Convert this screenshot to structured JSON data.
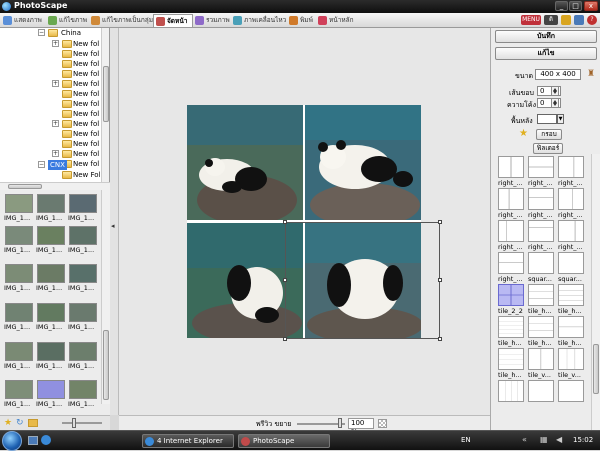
{
  "window": {
    "title": "PhotoScape"
  },
  "title_buttons": [
    "_",
    "□",
    "x"
  ],
  "tabs": [
    {
      "label": "แสดงภาพ",
      "color": "#5a8fd8"
    },
    {
      "label": "แก้ไขภาพ",
      "color": "#6aa84f"
    },
    {
      "label": "แก้ไขภาพเป็นกลุ่ม",
      "color": "#d08a3a"
    },
    {
      "label": "จัดหน้า",
      "color": "#c0504d"
    },
    {
      "label": "รวมภาพ",
      "color": "#8e6ac8"
    },
    {
      "label": "ภาพเคลื่อนไหว",
      "color": "#4aa0b8"
    },
    {
      "label": "พิมพ์",
      "color": "#d07a2a"
    },
    {
      "label": "หน้าหลัก",
      "color": "#d0405a"
    }
  ],
  "menu_buttons": [
    "MENU",
    "ดิ"
  ],
  "tree": {
    "root": "China",
    "items": [
      "New fol",
      "New fol",
      "New fol",
      "New fol",
      "New fol",
      "New fol",
      "New fol",
      "New fol",
      "New fol",
      "New fol",
      "New fol",
      "New fol",
      "New fol"
    ],
    "selected": "CNX",
    "after": [
      "New Fol",
      "New Fol"
    ]
  },
  "thumbnails": {
    "label": "IMG_1...",
    "colors": [
      "#8a9a80",
      "#6a7a70",
      "#5a6a72",
      "#7a8a7a",
      "#6a8060",
      "#5e7268",
      "#7c8c76",
      "#6b7b65",
      "#58706a",
      "#708272",
      "#627a60",
      "#6a7a6e",
      "#7a8a74",
      "#5a6e62",
      "#6c7e6c",
      "#7e8e78",
      "#68785e",
      "#76866e",
      "#6e7e74",
      "#9090e0",
      "#728468"
    ]
  },
  "canvas": {
    "cell_colors": [
      "#4a6a5a",
      "#3a6a7a",
      "#3b6a5a",
      "#4a6a72"
    ]
  },
  "bottombar": {
    "zoom_label": "พรีวิว ขยาย",
    "zoom_value": "100 %"
  },
  "right_panel": {
    "save": "บันทึก",
    "edit": "แก้ไข",
    "size_label": "ขนาด",
    "size_value": "400 x 400",
    "border_label": "เส้นขอบ",
    "border_value": "0",
    "spacing_label": "ความโค้ง",
    "spacing_value": "0",
    "bg_label": "พื้นหลัง",
    "frame_button": "กรอบ",
    "filter_button": "ฟิลเตอร์",
    "templates": [
      "right_...",
      "right_...",
      "right_...",
      "right_...",
      "right_...",
      "right_...",
      "right_...",
      "right_...",
      "right_...",
      "right_...",
      "squar...",
      "squar...",
      "tile_2_2",
      "tile_h...",
      "tile_h...",
      "tile_h...",
      "tile_h...",
      "tile_h...",
      "tile_h...",
      "tile_v...",
      "tile_v...",
      "",
      "",
      ""
    ]
  },
  "taskbar": {
    "ie": "4 Internet Explorer",
    "photoscape": "PhotoScape",
    "lang": "EN",
    "time": "15:02"
  }
}
